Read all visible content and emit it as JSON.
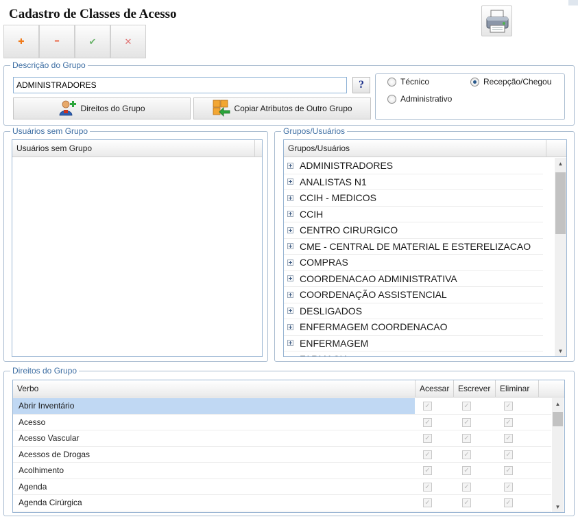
{
  "page": {
    "title": "Cadastro de Classes de Acesso"
  },
  "toolbar": {
    "add_glyph": "✚",
    "remove_glyph": "━",
    "confirm_glyph": "✔",
    "cancel_glyph": "✕",
    "icons": [
      "plus-icon",
      "minus-icon",
      "check-icon",
      "close-icon",
      "printer-icon"
    ]
  },
  "descricao": {
    "legend": "Descrição do Grupo",
    "input_value": "ADMINISTRADORES",
    "help_label": "?",
    "direitos_button": "Direitos do Grupo",
    "copiar_button": "Copiar Atributos de Outro Grupo",
    "radios": [
      {
        "label": "Técnico",
        "checked": false
      },
      {
        "label": "Recepção/Chegou",
        "checked": true
      },
      {
        "label": "Administrativo",
        "checked": false
      }
    ]
  },
  "usuarios_sem_grupo": {
    "legend": "Usuários sem Grupo",
    "column_header": "Usuários sem Grupo",
    "rows": []
  },
  "grupos_usuarios": {
    "legend": "Grupos/Usuários",
    "column_header": "Grupos/Usuários",
    "items": [
      "ADMINISTRADORES",
      "ANALISTAS N1",
      "CCIH - MEDICOS",
      "CCIH",
      "CENTRO CIRURGICO",
      "CME - CENTRAL DE MATERIAL E ESTERELIZACAO",
      "COMPRAS",
      "COORDENACAO ADMINISTRATIVA",
      "COORDENAÇÃO ASSISTENCIAL",
      "DESLIGADOS",
      "ENFERMAGEM COORDENACAO",
      "ENFERMAGEM",
      "FARMACIA"
    ]
  },
  "direitos": {
    "legend": "Direitos do Grupo",
    "columns": {
      "verbo": "Verbo",
      "acessar": "Acessar",
      "escrever": "Escrever",
      "eliminar": "Eliminar"
    },
    "rows": [
      {
        "verbo": "Abrir Inventário",
        "selected": true
      },
      {
        "verbo": "Acesso",
        "selected": false
      },
      {
        "verbo": "Acesso Vascular",
        "selected": false
      },
      {
        "verbo": "Acessos de Drogas",
        "selected": false
      },
      {
        "verbo": "Acolhimento",
        "selected": false
      },
      {
        "verbo": "Agenda",
        "selected": false
      },
      {
        "verbo": "Agenda Cirúrgica",
        "selected": false
      }
    ]
  },
  "colors": {
    "accent": "#3d6ea3",
    "border": "#99b5d3",
    "selection": "#c0d8f3"
  }
}
